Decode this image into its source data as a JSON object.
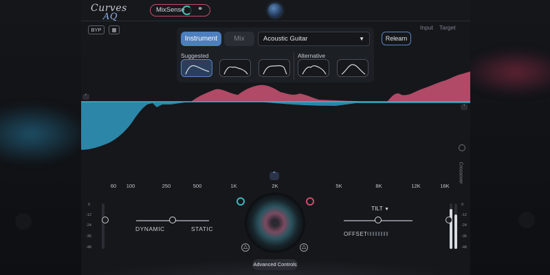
{
  "app": {
    "logo_main": "Curves",
    "logo_sub": "AQ",
    "mixsense_label": "MixSense",
    "bypass_label": "BYP",
    "input_label": "Input",
    "target_label": "Target"
  },
  "panel": {
    "tabs": [
      "Instrument",
      "Mix"
    ],
    "selected_instrument": "Acoustic Guitar",
    "suggested_label": "Suggested",
    "alternative_label": "Alternative",
    "relearn_label": "Relearn"
  },
  "frequency_labels": [
    "60",
    "100",
    "250",
    "500",
    "1K",
    "2K",
    "5K",
    "8K",
    "12K",
    "16K"
  ],
  "meter_scale": [
    "0",
    "-12",
    "-24",
    "-36",
    "-48"
  ],
  "meter_scale_right": [
    "0",
    "-12",
    "-24",
    "-36",
    "-48"
  ],
  "controls": {
    "dynamic_label": "DYNAMIC",
    "static_label": "STATIC",
    "tilt_label": "TILT",
    "offset_label": "OFFSET",
    "advanced_label": "Advanced Controls",
    "crossover_label": "Crossover"
  },
  "colors": {
    "accent_blue": "#4d7fbf",
    "target_line": "#3fb6c2",
    "boost_fill": "#b04a66",
    "cut_fill": "#2c86a8"
  },
  "icons": {
    "headphones": "headphones-icon",
    "orb": "globe-orb-icon",
    "chevron_up": "chevron-up-icon",
    "dropdown": "caret-down-icon",
    "tilt_caret": "caret-down-icon",
    "triangle": "triangle-icon"
  }
}
